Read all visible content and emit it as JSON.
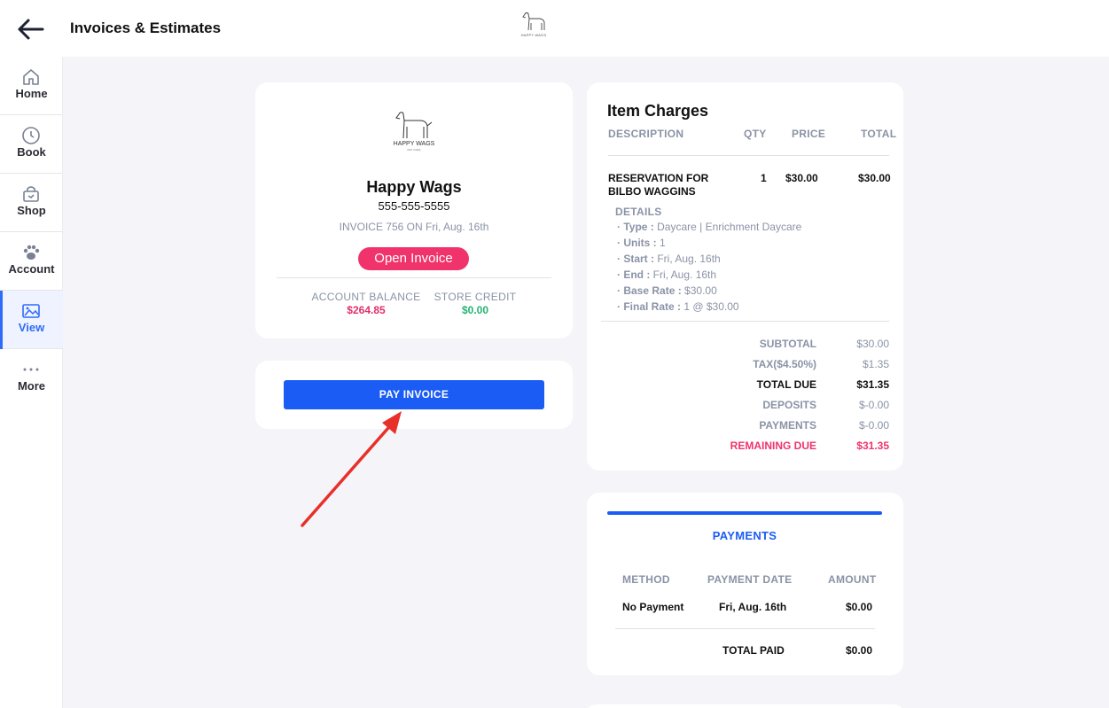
{
  "header": {
    "title": "Invoices & Estimates"
  },
  "sidebar": {
    "items": [
      {
        "label": "Home",
        "icon": "home-icon"
      },
      {
        "label": "Book",
        "icon": "clock-icon"
      },
      {
        "label": "Shop",
        "icon": "shop-icon"
      },
      {
        "label": "Account",
        "icon": "paw-icon"
      },
      {
        "label": "View",
        "icon": "image-icon",
        "active": true
      },
      {
        "label": "More",
        "icon": "ellipsis-icon"
      }
    ]
  },
  "logo": {
    "text": "HAPPY WAGS",
    "subtext": "PET CARE"
  },
  "business": {
    "name": "Happy Wags",
    "phone": "555-555-5555",
    "invoice_line": "INVOICE 756 ON Fri, Aug. 16th",
    "status_badge": "Open Invoice",
    "account_balance_label": "ACCOUNT BALANCE",
    "account_balance_value": "$264.85",
    "store_credit_label": "STORE CREDIT",
    "store_credit_value": "$0.00"
  },
  "pay_button": {
    "label": "PAY INVOICE"
  },
  "item_charges": {
    "title": "Item Charges",
    "columns": [
      "DESCRIPTION",
      "QTY",
      "PRICE",
      "TOTAL"
    ],
    "item": {
      "desc_line1": "RESERVATION FOR",
      "desc_line2": "BILBO WAGGINS",
      "qty": "1",
      "price": "$30.00",
      "total": "$30.00"
    },
    "details_label": "DETAILS",
    "details": [
      {
        "key": "· Type :",
        "value": "Daycare | Enrichment Daycare"
      },
      {
        "key": "· Units :",
        "value": "1"
      },
      {
        "key": "· Start :",
        "value": "Fri, Aug. 16th"
      },
      {
        "key": "· End :",
        "value": "Fri, Aug. 16th"
      },
      {
        "key": "· Base Rate :",
        "value": "$30.00"
      },
      {
        "key": "· Final Rate :",
        "value": "1 @ $30.00"
      }
    ],
    "summary": [
      {
        "label": "SUBTOTAL",
        "value": "$30.00"
      },
      {
        "label": "TAX($4.50%)",
        "value": "$1.35"
      },
      {
        "label": "TOTAL DUE",
        "value": "$31.35"
      },
      {
        "label": "DEPOSITS",
        "value": "$-0.00"
      },
      {
        "label": "PAYMENTS",
        "value": "$-0.00"
      },
      {
        "label": "REMAINING DUE",
        "value": "$31.35"
      }
    ]
  },
  "payments": {
    "title": "PAYMENTS",
    "columns": [
      "METHOD",
      "PAYMENT DATE",
      "AMOUNT"
    ],
    "row": {
      "method": "No Payment",
      "date": "Fri, Aug. 16th",
      "amount": "$0.00"
    },
    "total_label": "TOTAL PAID",
    "total_value": "$0.00"
  },
  "colors": {
    "accent": "#1b5cf5",
    "badge": "#f0336b",
    "balance": "#e0306a",
    "credit": "#22b573",
    "annotation_arrow": "#e8302a"
  }
}
